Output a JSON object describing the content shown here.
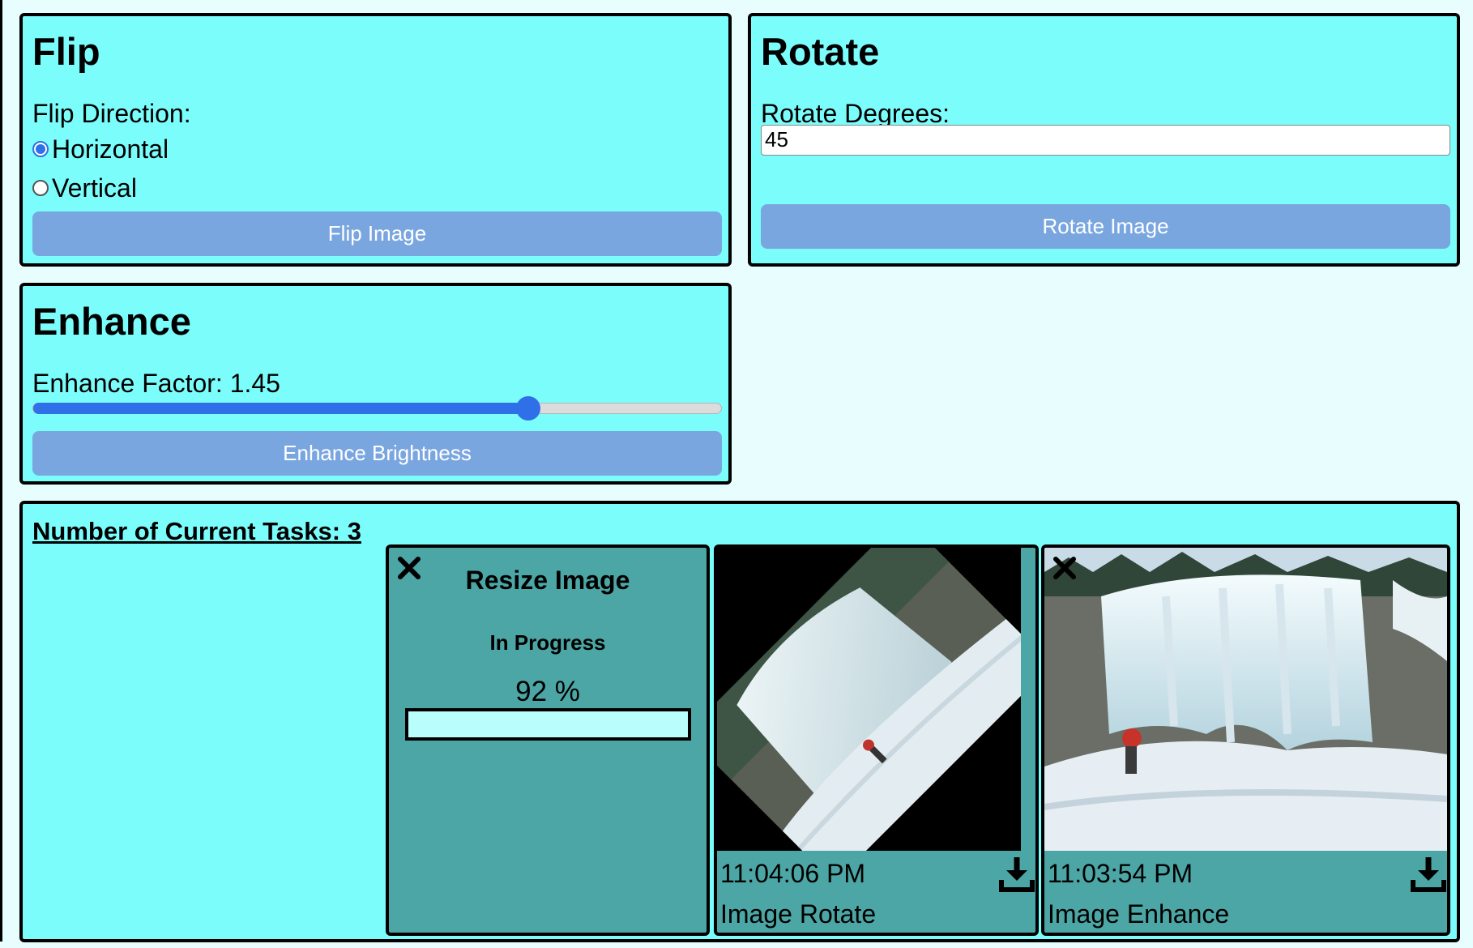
{
  "flip": {
    "title": "Flip",
    "direction_label": "Flip Direction:",
    "options": [
      {
        "label": "Horizontal",
        "checked": true
      },
      {
        "label": "Vertical",
        "checked": false
      }
    ],
    "button_label": "Flip Image"
  },
  "rotate": {
    "title": "Rotate",
    "degrees_label": "Rotate Degrees:",
    "degrees_value": "45",
    "button_label": "Rotate Image"
  },
  "enhance": {
    "title": "Enhance",
    "factor_label": "Enhance Factor: 1.45",
    "slider_fraction": 0.72,
    "button_label": "Enhance Brightness"
  },
  "tasks": {
    "heading": "Number of Current Tasks: 3",
    "items": [
      {
        "title": "Resize Image",
        "status": "In Progress",
        "percent_text": "92 %",
        "progress_fraction": 0.92
      },
      {
        "time": "11:04:06 PM",
        "name": "Image Rotate"
      },
      {
        "time": "11:03:54 PM",
        "name": "Image Enhance"
      }
    ]
  },
  "colors": {
    "page_bg": "#e8fefe",
    "panel_bg": "#7bfdfc",
    "button_bg": "#7aa6e0",
    "card_bg": "#4ca6a5",
    "accent": "#2f6fe8"
  }
}
